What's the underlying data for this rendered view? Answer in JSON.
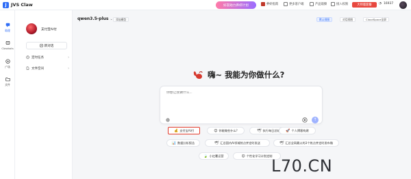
{
  "brand": {
    "name": "JVS Claw"
  },
  "topbar": {
    "promo": "好友助力养虾计划",
    "nav": [
      "养虾指南",
      "更多客户端",
      "产品观察",
      "接入权限",
      "喷入对话社群"
    ],
    "upgrade": "大师版套餐",
    "credits": "16937"
  },
  "rail": {
    "items": [
      {
        "label": "助理",
        "icon": "chat-icon"
      },
      {
        "label": "Clawbots",
        "icon": "bot-icon"
      },
      {
        "label": "广场",
        "icon": "plaza-icon"
      },
      {
        "label": "文件",
        "icon": "folder-icon"
      }
    ]
  },
  "panel": {
    "agent_name": "支付宝AI付",
    "new_chat": "新对话",
    "menu": [
      {
        "label": "定时任务",
        "icon": "clock-icon"
      },
      {
        "label": "文件空间",
        "icon": "file-icon"
      }
    ]
  },
  "main": {
    "model": "qwen3.5-plus",
    "add_model": "添加模型",
    "views": [
      "默认视图",
      "对话视图",
      "CloudSpace全屏"
    ],
    "greeting": "嗨~ 我能为你做什么?",
    "input_placeholder": "你想让我做什么...",
    "suggestions_row1": [
      "支付宝AI付",
      "你能做些什么?",
      "执行每日总结",
      "个人博客构建"
    ],
    "suggestions_row2": [
      "数据分析报告",
      "汇总国内AI领域热点并定时发送",
      "汇总全网最火的3个热点并定时发布微"
    ],
    "suggestions_row3": [
      "小红薯运营",
      "个性化学习计划定制"
    ]
  },
  "watermark": "L70.CN",
  "colors": {
    "accent": "#2f6df6",
    "highlight": "#e23b2b",
    "send": "#9fb3ff"
  }
}
